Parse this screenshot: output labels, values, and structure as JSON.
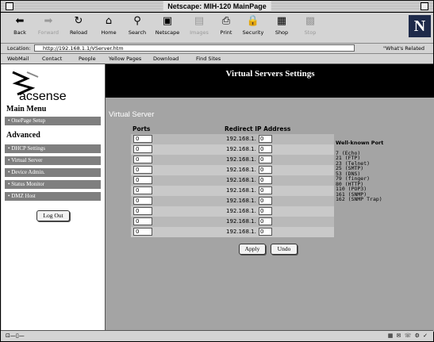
{
  "window": {
    "title": "Netscape: MIH-120 MainPage"
  },
  "toolbar": {
    "buttons": [
      {
        "label": "Back",
        "icon": "back-arrow-icon",
        "glyph": "⬅",
        "enabled": true
      },
      {
        "label": "Forward",
        "icon": "forward-arrow-icon",
        "glyph": "➡",
        "enabled": false
      },
      {
        "label": "Reload",
        "icon": "reload-icon",
        "glyph": "↻",
        "enabled": true
      },
      {
        "label": "Home",
        "icon": "home-icon",
        "glyph": "⌂",
        "enabled": true
      },
      {
        "label": "Search",
        "icon": "search-icon",
        "glyph": "⚲",
        "enabled": true
      },
      {
        "label": "Netscape",
        "icon": "netscape-icon",
        "glyph": "▣",
        "enabled": true
      },
      {
        "label": "Images",
        "icon": "images-icon",
        "glyph": "▤",
        "enabled": false
      },
      {
        "label": "Print",
        "icon": "print-icon",
        "glyph": "⎙",
        "enabled": true
      },
      {
        "label": "Security",
        "icon": "security-lock-icon",
        "glyph": "🔒",
        "enabled": true
      },
      {
        "label": "Shop",
        "icon": "shop-icon",
        "glyph": "▦",
        "enabled": true
      },
      {
        "label": "Stop",
        "icon": "stop-icon",
        "glyph": "▩",
        "enabled": false
      }
    ],
    "logo": "N"
  },
  "location": {
    "label": "Location:",
    "url": "http://192.168.1.1/VServer.htm",
    "related": "\"What's Related"
  },
  "personal_toolbar": [
    "WebMail",
    "Contact",
    "People",
    "Yellow Pages",
    "Download",
    "Find Sites"
  ],
  "sidebar": {
    "brand": "acsense",
    "main_menu": "Main Menu",
    "onepage": "OnePage Setup",
    "advanced": "Advanced",
    "items": [
      "DHCP Settings",
      "Virtual Server",
      "Device Admin.",
      "Status Monitor",
      "DMZ Host"
    ],
    "logout": "Log Out"
  },
  "page": {
    "heading": "Virtual Servers Settings",
    "section": "Virtual Server",
    "col_ports": "Ports",
    "col_ip": "Redirect IP Address",
    "ip_prefix": "192.168.1.",
    "rows": [
      {
        "port": "0",
        "ip": "0"
      },
      {
        "port": "0",
        "ip": "0"
      },
      {
        "port": "0",
        "ip": "0"
      },
      {
        "port": "0",
        "ip": "0"
      },
      {
        "port": "0",
        "ip": "0"
      },
      {
        "port": "0",
        "ip": "0"
      },
      {
        "port": "0",
        "ip": "0"
      },
      {
        "port": "0",
        "ip": "0"
      },
      {
        "port": "0",
        "ip": "0"
      },
      {
        "port": "0",
        "ip": "0"
      }
    ],
    "well_known_title": "Well-known Port",
    "well_known": [
      "7 (Echo)",
      "21 (FTP)",
      "23 (Telnet)",
      "25 (SMTP)",
      "53 (DNS)",
      "79 (finger)",
      "80 (HTTP)",
      "110 (POP3)",
      "161 (SNMP)",
      "162 (SNMP Trap)"
    ],
    "apply": "Apply",
    "undo": "Undo"
  }
}
